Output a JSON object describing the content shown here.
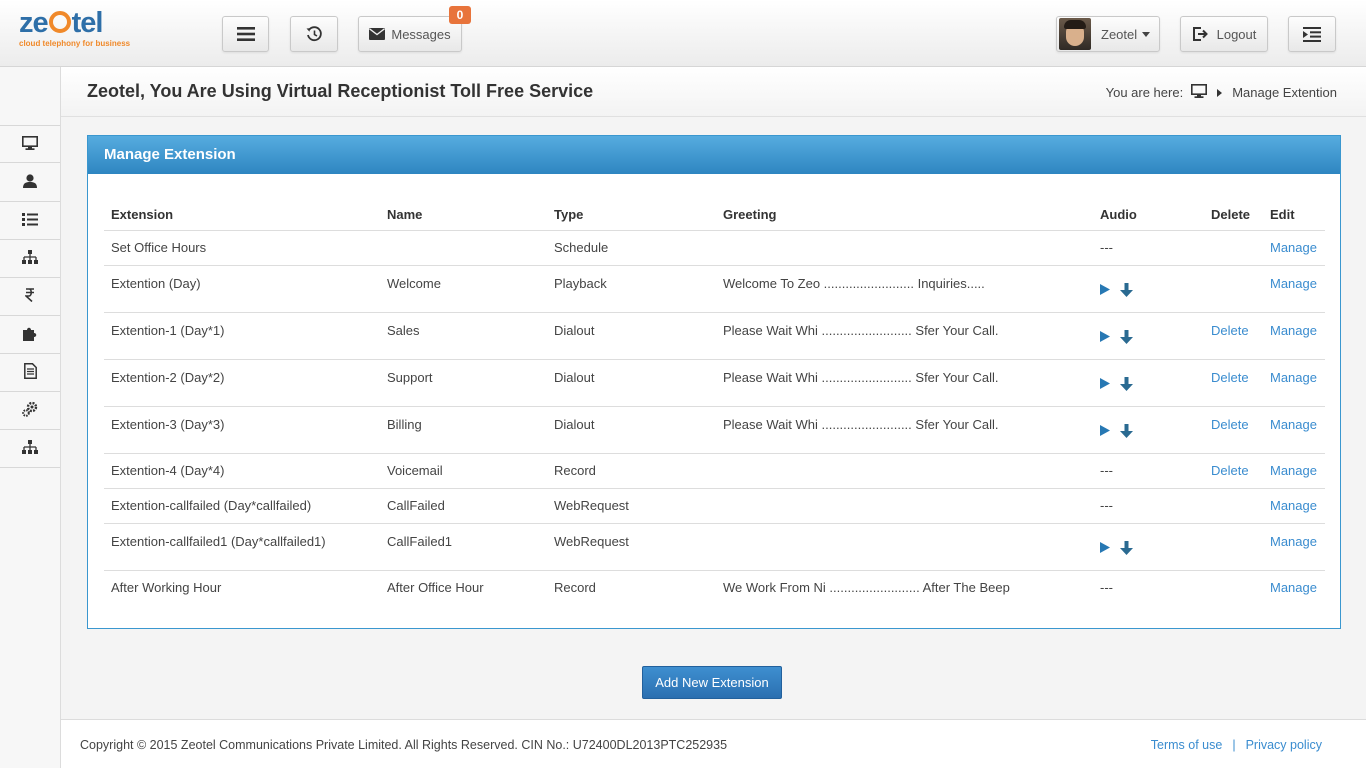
{
  "brand": {
    "logo_pre": "ze",
    "logo_post": "tel",
    "tagline": "cloud telephony for business"
  },
  "header": {
    "messages_label": "Messages",
    "messages_count": "0",
    "user_name": "Zeotel",
    "logout_label": "Logout"
  },
  "sidebar": {
    "items": [
      {
        "icon": "monitor-icon"
      },
      {
        "icon": "user-icon"
      },
      {
        "icon": "list-icon"
      },
      {
        "icon": "sitemap-icon"
      },
      {
        "icon": "rupee-icon"
      },
      {
        "icon": "puzzle-icon"
      },
      {
        "icon": "document-icon"
      },
      {
        "icon": "gears-icon"
      },
      {
        "icon": "hierarchy-icon"
      }
    ]
  },
  "page": {
    "title": "Zeotel, You Are Using Virtual Receptionist Toll Free Service",
    "breadcrumb_prefix": "You are here:",
    "breadcrumb_current": "Manage Extention"
  },
  "panel": {
    "title": "Manage Extension"
  },
  "table": {
    "headers": [
      "Extension",
      "Name",
      "Type",
      "Greeting",
      "Audio",
      "Delete",
      "Edit"
    ],
    "rows": [
      {
        "extension": "Set Office Hours",
        "name": "",
        "type": "Schedule",
        "greeting": "",
        "audio": "---",
        "delete": "",
        "edit": "Manage"
      },
      {
        "extension": "Extention (Day)",
        "name": "Welcome",
        "type": "Playback",
        "greeting": "Welcome To Zeo ......................... Inquiries.....",
        "audio": "icons",
        "delete": "",
        "edit": "Manage"
      },
      {
        "extension": "Extention-1 (Day*1)",
        "name": "Sales",
        "type": "Dialout",
        "greeting": "Please Wait Whi ......................... Sfer Your Call.",
        "audio": "icons",
        "delete": "Delete",
        "edit": "Manage"
      },
      {
        "extension": "Extention-2 (Day*2)",
        "name": "Support",
        "type": "Dialout",
        "greeting": "Please Wait Whi ......................... Sfer Your Call.",
        "audio": "icons",
        "delete": "Delete",
        "edit": "Manage"
      },
      {
        "extension": "Extention-3 (Day*3)",
        "name": "Billing",
        "type": "Dialout",
        "greeting": "Please Wait Whi ......................... Sfer Your Call.",
        "audio": "icons",
        "delete": "Delete",
        "edit": "Manage"
      },
      {
        "extension": "Extention-4 (Day*4)",
        "name": "Voicemail",
        "type": "Record",
        "greeting": "",
        "audio": "---",
        "delete": "Delete",
        "edit": "Manage"
      },
      {
        "extension": "Extention-callfailed (Day*callfailed)",
        "name": "CallFailed",
        "type": "WebRequest",
        "greeting": "",
        "audio": "---",
        "delete": "",
        "edit": "Manage"
      },
      {
        "extension": "Extention-callfailed1 (Day*callfailed1)",
        "name": "CallFailed1",
        "type": "WebRequest",
        "greeting": "",
        "audio": "icons",
        "delete": "",
        "edit": "Manage"
      },
      {
        "extension": "After Working Hour",
        "name": "After Office Hour",
        "type": "Record",
        "greeting": "We Work From Ni ......................... After The Beep",
        "audio": "---",
        "delete": "",
        "edit": "Manage"
      }
    ]
  },
  "actions": {
    "add_label": "Add New Extension"
  },
  "footer": {
    "copyright": "Copyright © 2015 Zeotel Communications Private Limited. All Rights Reserved. CIN No.: U72400DL2013PTC252935",
    "terms": "Terms of use",
    "separator": "|",
    "privacy": "Privacy policy"
  },
  "colors": {
    "accent": "#2e86c1",
    "link": "#3a8ccf",
    "brand_orange": "#f0892a",
    "brand_blue": "#2e6fa8",
    "badge": "#e8743b"
  }
}
